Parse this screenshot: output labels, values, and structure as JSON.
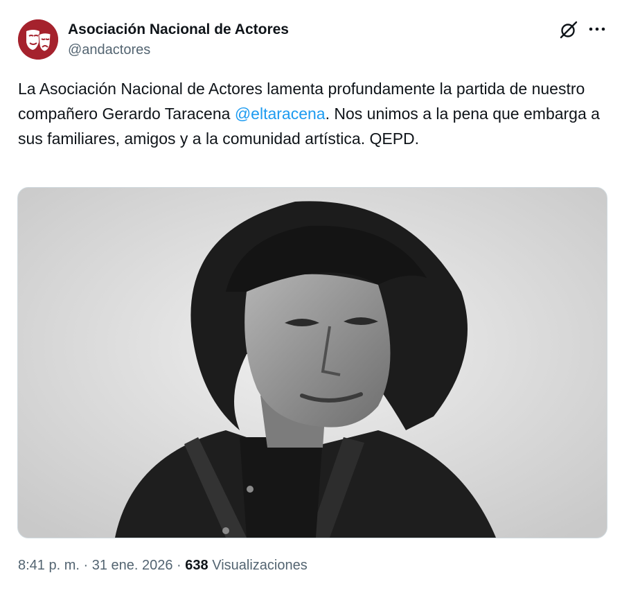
{
  "author": {
    "display_name": "Asociación Nacional de Actores",
    "handle": "@andactores",
    "avatar_icon": "theater-masks-logo",
    "brand_color": "#a5222d"
  },
  "header_actions": {
    "grok_icon": "grok-icon",
    "more_icon": "more-icon"
  },
  "tweet": {
    "text_part1": "La Asociación Nacional de Actores lamenta profundamente la partida de nuestro compañero Gerardo Taracena ",
    "mention": "@eltaracena",
    "text_part2": ". Nos unimos a la pena que embarga a sus familiares, amigos y a la comunidad artística. QEPD."
  },
  "meta": {
    "time": "8:41 p. m.",
    "separator1": " · ",
    "date": "31 ene. 2026",
    "separator2": " · ",
    "views_count": "638",
    "views_label": " Visualizaciones"
  },
  "colors": {
    "text": "#0f1419",
    "secondary": "#536471",
    "link": "#1d9bf0"
  }
}
